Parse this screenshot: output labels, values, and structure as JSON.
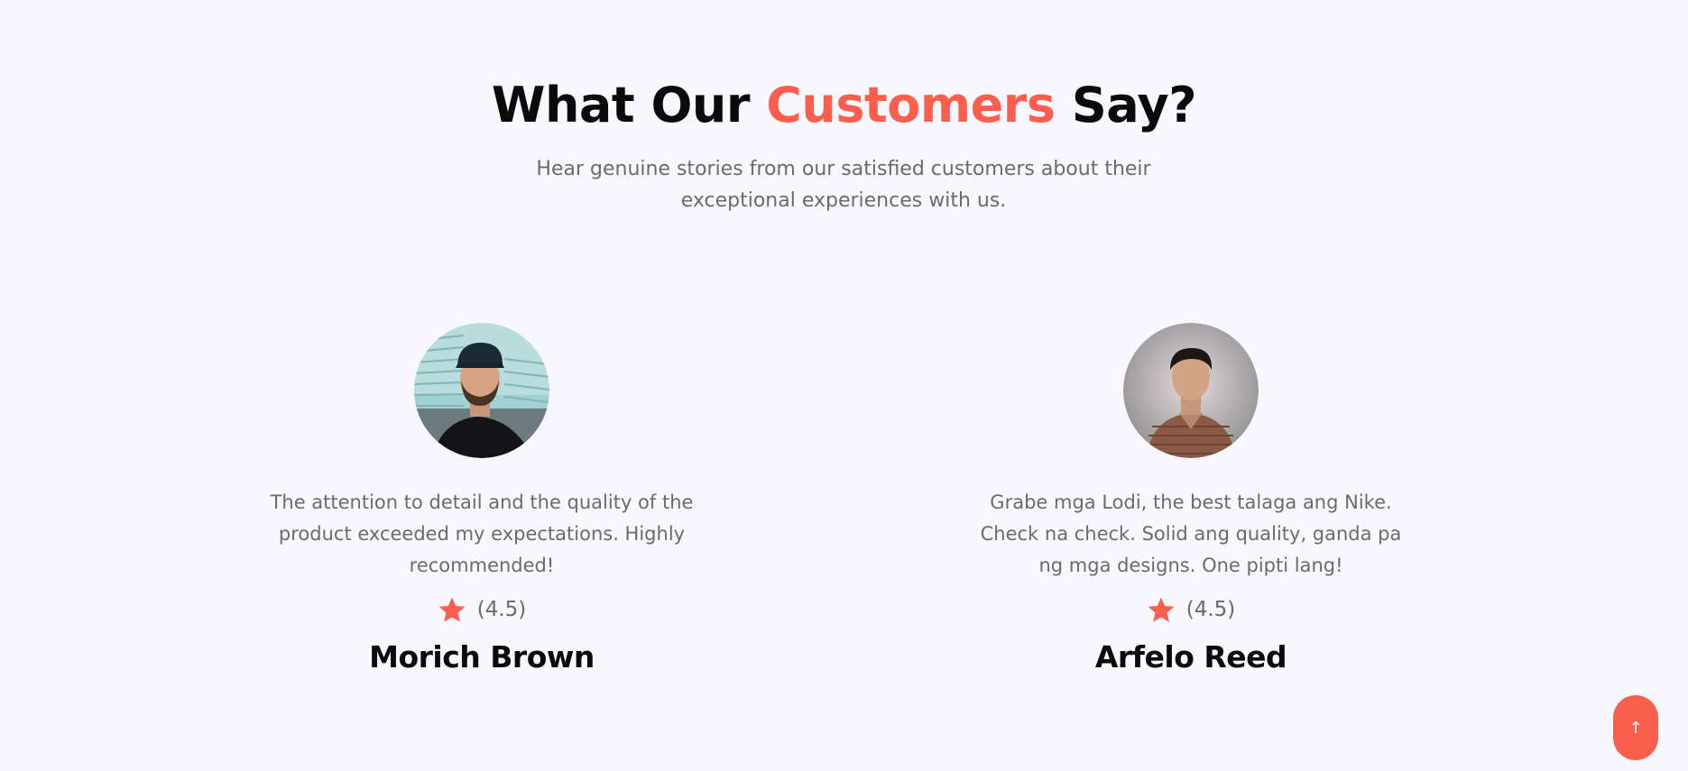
{
  "section": {
    "title_part1": "What Our ",
    "title_accent": "Customers",
    "title_part2": " Say?",
    "subtitle": "Hear genuine stories from our satisfied customers about their exceptional experiences with us.",
    "accent_color": "#fa5e4d"
  },
  "testimonials": [
    {
      "quote": "The attention to detail and the quality of the product exceeded my expectations. Highly recommended!",
      "rating": "(4.5)",
      "rating_icon": "star-icon",
      "name": "Morich Brown",
      "avatar": "avatar-photo"
    },
    {
      "quote": "Grabe mga Lodi, the best talaga ang Nike. Check na check. Solid ang quality, ganda pa ng mga designs. One pipti lang!",
      "rating": "(4.5)",
      "rating_icon": "star-icon",
      "name": "Arfelo Reed",
      "avatar": "avatar-photo"
    }
  ],
  "scroll_top": {
    "label": "↑",
    "icon": "arrow-up-icon"
  }
}
